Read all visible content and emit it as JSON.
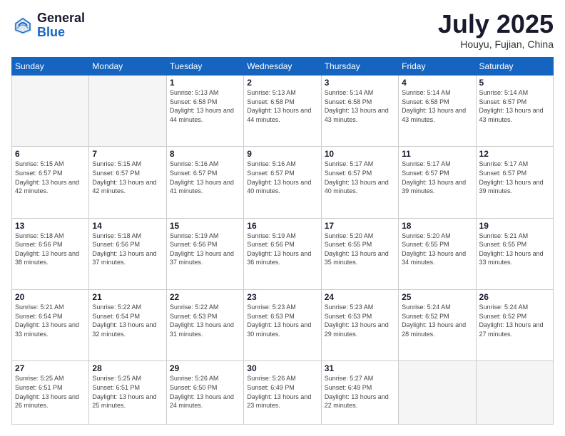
{
  "header": {
    "logo_general": "General",
    "logo_blue": "Blue",
    "month_title": "July 2025",
    "location": "Houyu, Fujian, China"
  },
  "weekdays": [
    "Sunday",
    "Monday",
    "Tuesday",
    "Wednesday",
    "Thursday",
    "Friday",
    "Saturday"
  ],
  "weeks": [
    [
      {
        "day": "",
        "empty": true
      },
      {
        "day": "",
        "empty": true
      },
      {
        "day": "1",
        "sunrise": "Sunrise: 5:13 AM",
        "sunset": "Sunset: 6:58 PM",
        "daylight": "Daylight: 13 hours and 44 minutes."
      },
      {
        "day": "2",
        "sunrise": "Sunrise: 5:13 AM",
        "sunset": "Sunset: 6:58 PM",
        "daylight": "Daylight: 13 hours and 44 minutes."
      },
      {
        "day": "3",
        "sunrise": "Sunrise: 5:14 AM",
        "sunset": "Sunset: 6:58 PM",
        "daylight": "Daylight: 13 hours and 43 minutes."
      },
      {
        "day": "4",
        "sunrise": "Sunrise: 5:14 AM",
        "sunset": "Sunset: 6:58 PM",
        "daylight": "Daylight: 13 hours and 43 minutes."
      },
      {
        "day": "5",
        "sunrise": "Sunrise: 5:14 AM",
        "sunset": "Sunset: 6:57 PM",
        "daylight": "Daylight: 13 hours and 43 minutes."
      }
    ],
    [
      {
        "day": "6",
        "sunrise": "Sunrise: 5:15 AM",
        "sunset": "Sunset: 6:57 PM",
        "daylight": "Daylight: 13 hours and 42 minutes."
      },
      {
        "day": "7",
        "sunrise": "Sunrise: 5:15 AM",
        "sunset": "Sunset: 6:57 PM",
        "daylight": "Daylight: 13 hours and 42 minutes."
      },
      {
        "day": "8",
        "sunrise": "Sunrise: 5:16 AM",
        "sunset": "Sunset: 6:57 PM",
        "daylight": "Daylight: 13 hours and 41 minutes."
      },
      {
        "day": "9",
        "sunrise": "Sunrise: 5:16 AM",
        "sunset": "Sunset: 6:57 PM",
        "daylight": "Daylight: 13 hours and 40 minutes."
      },
      {
        "day": "10",
        "sunrise": "Sunrise: 5:17 AM",
        "sunset": "Sunset: 6:57 PM",
        "daylight": "Daylight: 13 hours and 40 minutes."
      },
      {
        "day": "11",
        "sunrise": "Sunrise: 5:17 AM",
        "sunset": "Sunset: 6:57 PM",
        "daylight": "Daylight: 13 hours and 39 minutes."
      },
      {
        "day": "12",
        "sunrise": "Sunrise: 5:17 AM",
        "sunset": "Sunset: 6:57 PM",
        "daylight": "Daylight: 13 hours and 39 minutes."
      }
    ],
    [
      {
        "day": "13",
        "sunrise": "Sunrise: 5:18 AM",
        "sunset": "Sunset: 6:56 PM",
        "daylight": "Daylight: 13 hours and 38 minutes."
      },
      {
        "day": "14",
        "sunrise": "Sunrise: 5:18 AM",
        "sunset": "Sunset: 6:56 PM",
        "daylight": "Daylight: 13 hours and 37 minutes."
      },
      {
        "day": "15",
        "sunrise": "Sunrise: 5:19 AM",
        "sunset": "Sunset: 6:56 PM",
        "daylight": "Daylight: 13 hours and 37 minutes."
      },
      {
        "day": "16",
        "sunrise": "Sunrise: 5:19 AM",
        "sunset": "Sunset: 6:56 PM",
        "daylight": "Daylight: 13 hours and 36 minutes."
      },
      {
        "day": "17",
        "sunrise": "Sunrise: 5:20 AM",
        "sunset": "Sunset: 6:55 PM",
        "daylight": "Daylight: 13 hours and 35 minutes."
      },
      {
        "day": "18",
        "sunrise": "Sunrise: 5:20 AM",
        "sunset": "Sunset: 6:55 PM",
        "daylight": "Daylight: 13 hours and 34 minutes."
      },
      {
        "day": "19",
        "sunrise": "Sunrise: 5:21 AM",
        "sunset": "Sunset: 6:55 PM",
        "daylight": "Daylight: 13 hours and 33 minutes."
      }
    ],
    [
      {
        "day": "20",
        "sunrise": "Sunrise: 5:21 AM",
        "sunset": "Sunset: 6:54 PM",
        "daylight": "Daylight: 13 hours and 33 minutes."
      },
      {
        "day": "21",
        "sunrise": "Sunrise: 5:22 AM",
        "sunset": "Sunset: 6:54 PM",
        "daylight": "Daylight: 13 hours and 32 minutes."
      },
      {
        "day": "22",
        "sunrise": "Sunrise: 5:22 AM",
        "sunset": "Sunset: 6:53 PM",
        "daylight": "Daylight: 13 hours and 31 minutes."
      },
      {
        "day": "23",
        "sunrise": "Sunrise: 5:23 AM",
        "sunset": "Sunset: 6:53 PM",
        "daylight": "Daylight: 13 hours and 30 minutes."
      },
      {
        "day": "24",
        "sunrise": "Sunrise: 5:23 AM",
        "sunset": "Sunset: 6:53 PM",
        "daylight": "Daylight: 13 hours and 29 minutes."
      },
      {
        "day": "25",
        "sunrise": "Sunrise: 5:24 AM",
        "sunset": "Sunset: 6:52 PM",
        "daylight": "Daylight: 13 hours and 28 minutes."
      },
      {
        "day": "26",
        "sunrise": "Sunrise: 5:24 AM",
        "sunset": "Sunset: 6:52 PM",
        "daylight": "Daylight: 13 hours and 27 minutes."
      }
    ],
    [
      {
        "day": "27",
        "sunrise": "Sunrise: 5:25 AM",
        "sunset": "Sunset: 6:51 PM",
        "daylight": "Daylight: 13 hours and 26 minutes."
      },
      {
        "day": "28",
        "sunrise": "Sunrise: 5:25 AM",
        "sunset": "Sunset: 6:51 PM",
        "daylight": "Daylight: 13 hours and 25 minutes."
      },
      {
        "day": "29",
        "sunrise": "Sunrise: 5:26 AM",
        "sunset": "Sunset: 6:50 PM",
        "daylight": "Daylight: 13 hours and 24 minutes."
      },
      {
        "day": "30",
        "sunrise": "Sunrise: 5:26 AM",
        "sunset": "Sunset: 6:49 PM",
        "daylight": "Daylight: 13 hours and 23 minutes."
      },
      {
        "day": "31",
        "sunrise": "Sunrise: 5:27 AM",
        "sunset": "Sunset: 6:49 PM",
        "daylight": "Daylight: 13 hours and 22 minutes."
      },
      {
        "day": "",
        "empty": true
      },
      {
        "day": "",
        "empty": true
      }
    ]
  ]
}
